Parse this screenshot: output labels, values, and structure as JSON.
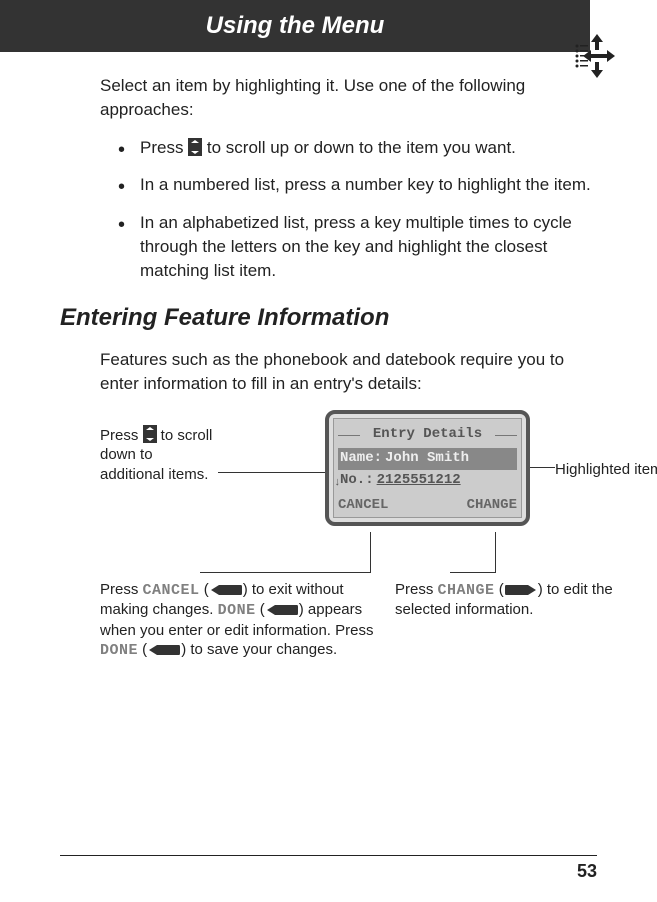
{
  "header": {
    "title": "Using the Menu"
  },
  "intro": "Select an item by highlighting it. Use one of the following approaches:",
  "bullets": [
    {
      "pre": "Press ",
      "post": " to scroll up or down to the item you want."
    },
    {
      "text": "In a numbered list, press a number key to highlight the item."
    },
    {
      "text": "In an alphabetized list, press a key multiple times to cycle through the letters on the key and highlight the closest matching list item."
    }
  ],
  "section_heading": "Entering Feature Information",
  "section_intro": "Features such as the phonebook and datebook require you to enter information to fill in an entry's details:",
  "screen": {
    "title": "Entry Details",
    "name_label": "Name:",
    "name_value": "John Smith",
    "no_label": "No.:",
    "no_value": "2125551212",
    "left_soft": "CANCEL",
    "right_soft": "CHANGE"
  },
  "annotations": {
    "scroll": {
      "pre": "Press ",
      "post": " to scroll down to additional items."
    },
    "highlighted": "Highlighted item",
    "cancel": {
      "t1a": "Press ",
      "t1b": "CANCEL",
      "t1c": " (",
      "t1d": ") to exit without making changes. ",
      "t2a": "DONE",
      "t2b": " (",
      "t2c": ") appears when you enter or edit information. Press ",
      "t3a": "DONE",
      "t3b": " (",
      "t3c": ") to save your changes."
    },
    "change": {
      "a": "Press ",
      "b": "CHANGE",
      "c": " (",
      "d": ") to edit the selected information."
    }
  },
  "page_number": "53"
}
